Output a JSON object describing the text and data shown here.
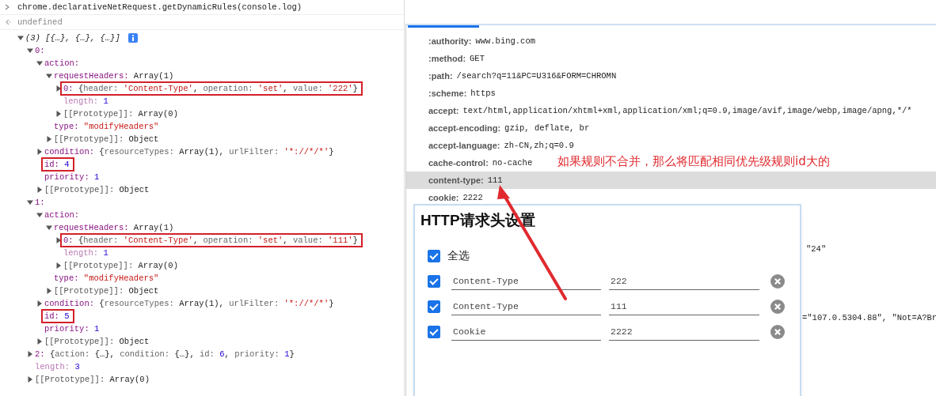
{
  "console": {
    "entries": [
      {
        "kind": "input",
        "text": "chrome.declarativeNetRequest.getDynamicRules(console.log)"
      },
      {
        "kind": "result",
        "text": "undefined"
      }
    ],
    "tree": {
      "value": "(3) [{…}, {…}, {…}]",
      "kind": "summary",
      "expanded": true,
      "boxed": false,
      "children": [
        {
          "key": "0:",
          "kind": "property",
          "expanded": true,
          "boxed": false,
          "children": [
            {
              "key": "action:",
              "kind": "property",
              "expanded": true,
              "boxed": false,
              "children": [
                {
                  "key": "requestHeaders:",
                  "value": "Array(1)",
                  "kind": "property",
                  "expanded": true,
                  "boxed": false,
                  "children": [
                    {
                      "key": "0:",
                      "value": "{header: 'Content-Type', operation: 'set', value: '222'}",
                      "kind": "property",
                      "expanded": false,
                      "boxed": true
                    },
                    {
                      "key": "length:",
                      "value": "1",
                      "kind": "nonenumerable",
                      "boxed": false
                    },
                    {
                      "key": "[[Prototype]]:",
                      "value": "Array(0)",
                      "kind": "internal",
                      "expanded": false,
                      "boxed": false
                    }
                  ]
                },
                {
                  "key": "type:",
                  "value": "\"modifyHeaders\"",
                  "kind": "property",
                  "boxed": false
                },
                {
                  "key": "[[Prototype]]:",
                  "value": "Object",
                  "kind": "internal",
                  "expanded": false,
                  "boxed": false
                }
              ]
            },
            {
              "key": "condition:",
              "value": "{resourceTypes: Array(1), urlFilter: '*://*/*'}",
              "kind": "property",
              "expanded": false,
              "boxed": false
            },
            {
              "key": "id:",
              "value": "4",
              "kind": "property",
              "boxed": true
            },
            {
              "key": "priority:",
              "value": "1",
              "kind": "property",
              "boxed": false
            },
            {
              "key": "[[Prototype]]:",
              "value": "Object",
              "kind": "internal",
              "expanded": false,
              "boxed": false
            }
          ]
        },
        {
          "key": "1:",
          "kind": "property",
          "expanded": true,
          "boxed": false,
          "children": [
            {
              "key": "action:",
              "kind": "property",
              "expanded": true,
              "boxed": false,
              "children": [
                {
                  "key": "requestHeaders:",
                  "value": "Array(1)",
                  "kind": "property",
                  "expanded": true,
                  "boxed": false,
                  "children": [
                    {
                      "key": "0:",
                      "value": "{header: 'Content-Type', operation: 'set', value: '111'}",
                      "kind": "property",
                      "expanded": false,
                      "boxed": true
                    },
                    {
                      "key": "length:",
                      "value": "1",
                      "kind": "nonenumerable",
                      "boxed": false
                    },
                    {
                      "key": "[[Prototype]]:",
                      "value": "Array(0)",
                      "kind": "internal",
                      "expanded": false,
                      "boxed": false
                    }
                  ]
                },
                {
                  "key": "type:",
                  "value": "\"modifyHeaders\"",
                  "kind": "property",
                  "boxed": false
                },
                {
                  "key": "[[Prototype]]:",
                  "value": "Object",
                  "kind": "internal",
                  "expanded": false,
                  "boxed": false
                }
              ]
            },
            {
              "key": "condition:",
              "value": "{resourceTypes: Array(1), urlFilter: '*://*/*'}",
              "kind": "property",
              "expanded": false,
              "boxed": false
            },
            {
              "key": "id:",
              "value": "5",
              "kind": "property",
              "boxed": true
            },
            {
              "key": "priority:",
              "value": "1",
              "kind": "property",
              "boxed": false
            },
            {
              "key": "[[Prototype]]:",
              "value": "Object",
              "kind": "internal",
              "expanded": false,
              "boxed": false
            }
          ]
        },
        {
          "key": "2:",
          "value": "{action: {…}, condition: {…}, id: 6, priority: 1}",
          "kind": "property",
          "expanded": false,
          "boxed": false
        },
        {
          "key": "length:",
          "value": "3",
          "kind": "nonenumerable",
          "boxed": false
        },
        {
          "key": "[[Prototype]]:",
          "value": "Array(0)",
          "kind": "internal",
          "expanded": false,
          "boxed": false
        }
      ]
    }
  },
  "request_headers": {
    "rows": [
      {
        "name": ":authority:",
        "value": "www.bing.com",
        "selected": false
      },
      {
        "name": ":method:",
        "value": "GET",
        "selected": false
      },
      {
        "name": ":path:",
        "value": "/search?q=11&PC=U316&FORM=CHROMN",
        "selected": false
      },
      {
        "name": ":scheme:",
        "value": "https",
        "selected": false
      },
      {
        "name": "accept:",
        "value": "text/html,application/xhtml+xml,application/xml;q=0.9,image/avif,image/webp,image/apng,*/*",
        "selected": false
      },
      {
        "name": "accept-encoding:",
        "value": "gzip, deflate, br",
        "selected": false
      },
      {
        "name": "accept-language:",
        "value": "zh-CN,zh;q=0.9",
        "selected": false
      },
      {
        "name": "cache-control:",
        "value": "no-cache",
        "selected": false
      },
      {
        "name": "content-type:",
        "value": "111",
        "selected": true
      },
      {
        "name": "cookie:",
        "value": "2222",
        "selected": false
      }
    ],
    "partial_values": [
      "\"24\"",
      "=\"107.0.5304.88\", \"Not=A?Br"
    ]
  },
  "annotation": {
    "text": "如果规则不合并，那么将匹配相同优先级规则id大的"
  },
  "popup": {
    "title": "HTTP请求头设置",
    "select_all": {
      "label": "全选",
      "checked": true
    },
    "headers": [
      {
        "checked": true,
        "name": "Content-Type",
        "value": "222"
      },
      {
        "checked": true,
        "name": "Content-Type",
        "value": "111"
      },
      {
        "checked": true,
        "name": "Cookie",
        "value": "2222"
      }
    ]
  }
}
